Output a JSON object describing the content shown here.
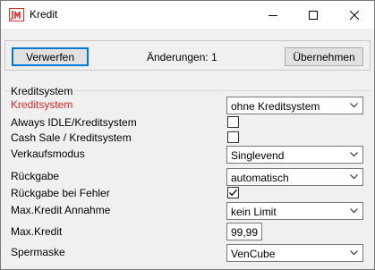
{
  "window": {
    "title": "Kredit",
    "app_icon": "jm-logo-icon",
    "controls": [
      "minimize-icon",
      "maximize-icon",
      "close-icon"
    ]
  },
  "toolbar": {
    "discard_label": "Verwerfen",
    "changes_text": "Änderungen: 1",
    "apply_label": "Übernehmen"
  },
  "section": {
    "title": "Kreditsystem"
  },
  "fields": {
    "kreditsystem": {
      "label": "Kreditsystem",
      "value": "ohne Kreditsystem",
      "label_color": "#e0282a"
    },
    "always_idle": {
      "label": "Always IDLE/Kreditsystem",
      "checked": false
    },
    "cash_sale": {
      "label": "Cash Sale / Kreditsystem",
      "checked": false
    },
    "verkaufsmodus": {
      "label": "Verkaufsmodus",
      "value": "Singlevend"
    },
    "rueckgabe": {
      "label": "Rückgabe",
      "value": "automatisch"
    },
    "rueckgabe_fehler": {
      "label": "Rückgabe bei Fehler",
      "checked": true
    },
    "max_kredit_annahme": {
      "label": "Max.Kredit Annahme",
      "value": "kein Limit"
    },
    "max_kredit": {
      "label": "Max.Kredit",
      "value": "99,99"
    },
    "spermaske": {
      "label": "Spermaske",
      "value": "VenCube"
    }
  },
  "colors": {
    "accent": "#0078d7",
    "highlight_label": "#e0282a",
    "logo": "#d0342c"
  }
}
